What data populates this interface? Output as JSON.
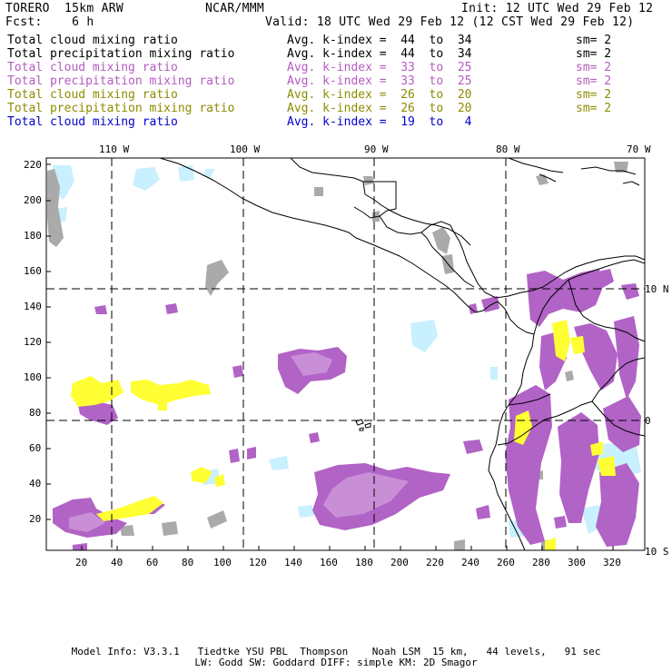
{
  "header": {
    "model": "TORERO  15km ARW",
    "org": "NCAR/MMM",
    "init": "Init: 12 UTC Wed 29 Feb 12",
    "fcst": "Fcst:    6 h",
    "valid": "Valid: 18 UTC Wed 29 Feb 12 (12 CST Wed 29 Feb 12)"
  },
  "legend": [
    {
      "name": "Total cloud mixing ratio",
      "kindex": "Avg. k-index =  44  to  34",
      "sm": "sm= 2",
      "color": "#000000"
    },
    {
      "name": "Total precipitation mixing ratio",
      "kindex": "Avg. k-index =  44  to  34",
      "sm": "sm= 2",
      "color": "#000000"
    },
    {
      "name": "Total cloud mixing ratio",
      "kindex": "Avg. k-index =  33  to  25",
      "sm": "sm= 2",
      "color": "#b45cc0"
    },
    {
      "name": "Total precipitation mixing ratio",
      "kindex": "Avg. k-index =  33  to  25",
      "sm": "sm= 2",
      "color": "#b45cc0"
    },
    {
      "name": "Total cloud mixing ratio",
      "kindex": "Avg. k-index =  26  to  20",
      "sm": "sm= 2",
      "color": "#8c8c00"
    },
    {
      "name": "Total precipitation mixing ratio",
      "kindex": "Avg. k-index =  26  to  20",
      "sm": "sm= 2",
      "color": "#8c8c00"
    },
    {
      "name": "Total cloud mixing ratio",
      "kindex": "Avg. k-index =  19  to   4",
      "sm": "",
      "color": "#0000d0"
    }
  ],
  "top_axis": [
    "110 W",
    "100 W",
    "90 W",
    "80 W",
    "70 W"
  ],
  "right_axis": [
    "10 N",
    "0",
    "10 S"
  ],
  "left_axis": [
    "220",
    "200",
    "180",
    "160",
    "140",
    "120",
    "100",
    "80",
    "60",
    "40",
    "20"
  ],
  "bottom_axis": [
    "20",
    "40",
    "60",
    "80",
    "100",
    "120",
    "140",
    "160",
    "180",
    "200",
    "220",
    "240",
    "260",
    "280",
    "300",
    "320"
  ],
  "footer": {
    "line1": "Model Info: V3.3.1   Tiedtke YSU PBL  Thompson    Noah LSM  15 km,   44 levels,   91 sec",
    "line2": "LW: Godd SW: Goddard DIFF: simple KM: 2D Smagor"
  },
  "colors": {
    "gray": "#aaaaaa",
    "purple": "#b163c6",
    "light_purple": "#c98fd6",
    "yellow": "#ffff33",
    "light_blue": "#c8f0ff",
    "coast": "#000000",
    "grid": "#000000"
  }
}
